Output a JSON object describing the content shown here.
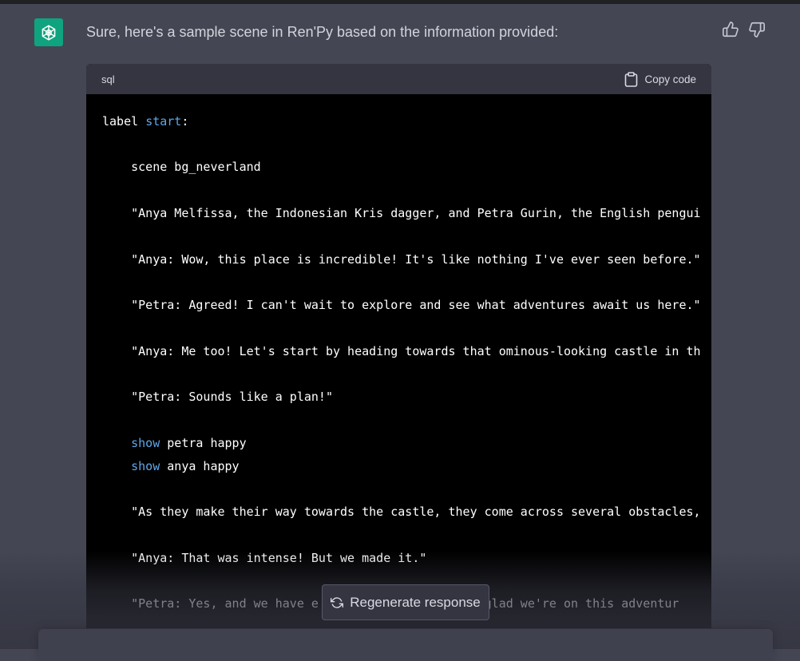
{
  "message": {
    "intro": "Sure, here's a sample scene in Ren'Py based on the information provided:"
  },
  "feedback": {
    "thumbs_up_icon": "thumbs-up-icon",
    "thumbs_down_icon": "thumbs-down-icon"
  },
  "code_block": {
    "language": "sql",
    "copy_label": "Copy code",
    "lines": [
      {
        "pre": "label ",
        "kw": "start",
        "post": ":"
      },
      {
        "pre": "    scene bg_neverland"
      },
      {
        "pre": "    \"Anya Melfissa, the Indonesian Kris dagger, and Petra Gurin, the English pengui"
      },
      {
        "pre": "    \"Anya: Wow, this place is incredible! It's like nothing I've ever seen before.\""
      },
      {
        "pre": "    \"Petra: Agreed! I can't wait to explore and see what adventures await us here.\""
      },
      {
        "pre": "    \"Anya: Me too! Let's start by heading towards that ominous-looking castle in th"
      },
      {
        "pre": "    \"Petra: Sounds like a plan!\""
      },
      {
        "pre": "    ",
        "kw": "show",
        "post": " petra happy"
      },
      {
        "pre": "    ",
        "kw": "show",
        "post": " anya happy"
      },
      {
        "pre": "    \"As they make their way towards the castle, they come across several obstacles,"
      },
      {
        "pre": "    \"Anya: That was intense! But we made it.\""
      },
      {
        "pre": "    \"Petra: Yes, and we have e                   I'm glad we're on this adventur"
      }
    ]
  },
  "regenerate": {
    "label": "Regenerate response",
    "icon": "refresh-icon"
  },
  "colors": {
    "background": "#444654",
    "accent": "#10a37f",
    "keyword": "#5fa7e8",
    "code_bg": "#000000"
  }
}
